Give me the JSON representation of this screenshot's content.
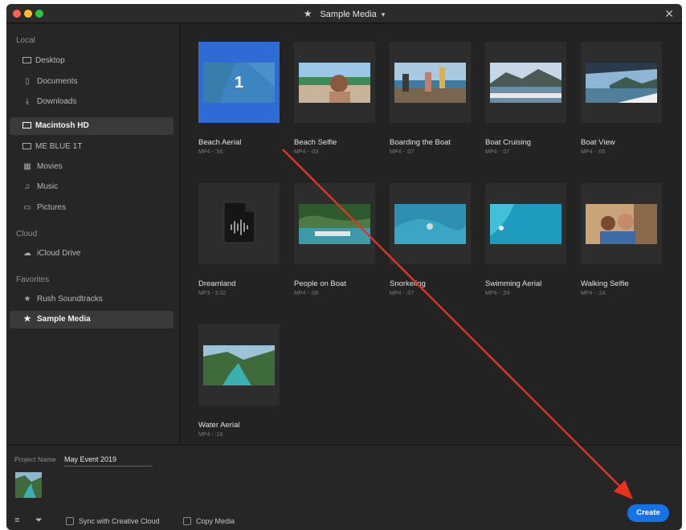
{
  "window": {
    "title": "Sample Media"
  },
  "sidebar": {
    "sections": [
      {
        "label": "Local",
        "items": [
          {
            "label": "Desktop",
            "icon": "desktop-icon"
          },
          {
            "label": "Documents",
            "icon": "document-icon"
          },
          {
            "label": "Downloads",
            "icon": "download-icon"
          },
          {
            "label": "Macintosh HD",
            "icon": "monitor-icon",
            "selected": true
          },
          {
            "label": "ME BLUE 1T",
            "icon": "monitor-icon"
          },
          {
            "label": "Movies",
            "icon": "film-icon"
          },
          {
            "label": "Music",
            "icon": "music-note-icon"
          },
          {
            "label": "Pictures",
            "icon": "image-icon"
          }
        ]
      },
      {
        "label": "Cloud",
        "items": [
          {
            "label": "iCloud Drive",
            "icon": "cloud-icon"
          }
        ]
      },
      {
        "label": "Favorites",
        "items": [
          {
            "label": "Rush Soundtracks",
            "icon": "star-icon"
          },
          {
            "label": "Sample Media",
            "icon": "star-icon",
            "selected": true
          }
        ]
      }
    ]
  },
  "media": [
    {
      "title": "Beach Aerial",
      "meta": "MP4 - :56",
      "selected": true,
      "badge": "1"
    },
    {
      "title": "Beach Selfie",
      "meta": "MP4 - :03"
    },
    {
      "title": "Boarding the Boat",
      "meta": "MP4 - :07"
    },
    {
      "title": "Boat Cruising",
      "meta": "MP4 - :07"
    },
    {
      "title": "Boat View",
      "meta": "MP4 - :05"
    },
    {
      "title": "Dreamland",
      "meta": "MP3 - 3:32"
    },
    {
      "title": "People on Boat",
      "meta": "MP4 - :05"
    },
    {
      "title": "Snorkeling",
      "meta": "MP4 - :07"
    },
    {
      "title": "Swimming Aerial",
      "meta": "MP4 - :24"
    },
    {
      "title": "Walking Selfie",
      "meta": "MP4 - :24"
    },
    {
      "title": "Water Aerial",
      "meta": "MP4 - :18"
    }
  ],
  "footer": {
    "project_name_label": "Project Name",
    "project_name_value": "May Event 2019",
    "sync_label": "Sync with Creative Cloud",
    "copy_label": "Copy Media",
    "create_label": "Create"
  },
  "colors": {
    "accent": "#1473e6",
    "selection": "#2f6bd4",
    "annotation_arrow": "#e8321e"
  }
}
